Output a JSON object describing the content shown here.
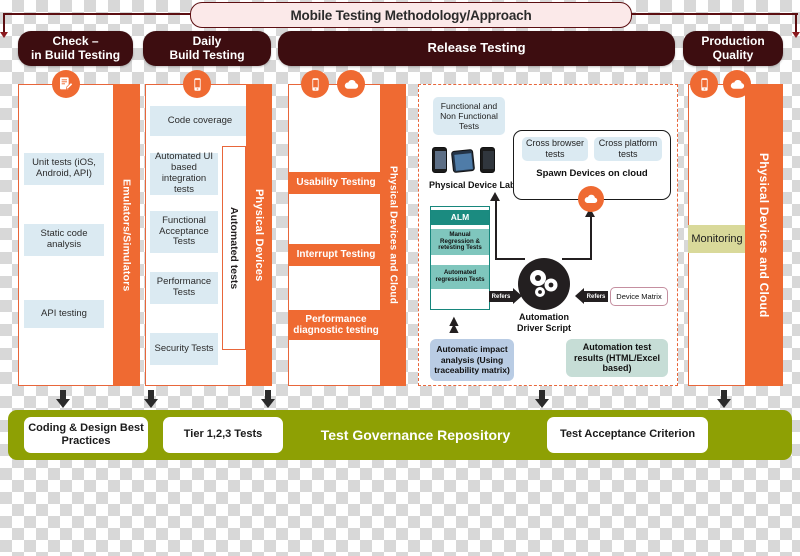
{
  "header": {
    "title": "Mobile Testing Methodology/Approach",
    "phases": [
      {
        "label": "Check –\nin Build Testing"
      },
      {
        "label": "Daily\nBuild Testing"
      },
      {
        "label": "Release Testing"
      },
      {
        "label": "Production\nQuality"
      }
    ]
  },
  "columns": [
    {
      "id": "check-in-build-testing",
      "icon": "document-edit-icon",
      "side_label": "Emulators/Simulators",
      "items": [
        {
          "label": "Unit tests (iOS, Android, API)"
        },
        {
          "label": "Static code analysis"
        },
        {
          "label": "API testing"
        }
      ]
    },
    {
      "id": "daily-build-testing",
      "icon": "mobile-phone-icon",
      "side_label": "Physical Devices",
      "group_label": "Automated tests",
      "items": [
        {
          "label": "Code coverage"
        },
        {
          "label": "Automated UI based integration tests"
        },
        {
          "label": "Functional Acceptance Tests"
        },
        {
          "label": "Performance Tests"
        },
        {
          "label": "Security Tests"
        }
      ]
    },
    {
      "id": "release-testing-manual",
      "icons": [
        "mobile-phone-icon",
        "cloud-icon"
      ],
      "side_label": "Physical Devices and Cloud",
      "items": [
        {
          "label": "Usability Testing"
        },
        {
          "label": "Interrupt Testing"
        },
        {
          "label": "Performance diagnostic testing"
        }
      ]
    },
    {
      "id": "production-quality",
      "icons": [
        "mobile-phone-icon",
        "cloud-icon"
      ],
      "side_label": "Physical Devices and Cloud",
      "items": [
        {
          "label": "Monitoring"
        }
      ]
    }
  ],
  "release_detail": {
    "functional_tests_box": "Functional and Non Functional Tests",
    "device_lab_label": "Physical Device Lab",
    "cloud_box": {
      "cross_browser": "Cross browser tests",
      "cross_platform": "Cross platform tests",
      "caption": "Spawn Devices on cloud",
      "icon": "cloud-icon"
    },
    "alm_stack": {
      "header": "ALM",
      "rows": [
        "Manual Regression & retesting Tests",
        "Automated regression Tests"
      ]
    },
    "automation_driver": {
      "label": "Automation Driver Script",
      "icon": "gears-icon"
    },
    "refers_left": "Refers",
    "refers_right": "Refers",
    "device_matrix": "Device Matrix",
    "impact_analysis": "Automatic impact analysis (Using traceability matrix)",
    "test_results": "Automation test results (HTML/Excel based)"
  },
  "governance": {
    "title": "Test Governance Repository",
    "cards": [
      {
        "label": "Coding & Design Best Practices"
      },
      {
        "label": "Tier 1,2,3 Tests"
      },
      {
        "label": "Test Acceptance Criterion"
      }
    ]
  },
  "colors": {
    "accent_orange": "#ef6a32",
    "dark_maroon": "#3d0d10",
    "olive": "#8ea004",
    "teal": "#1b8b80",
    "chip_blue": "#dbeaf2"
  }
}
